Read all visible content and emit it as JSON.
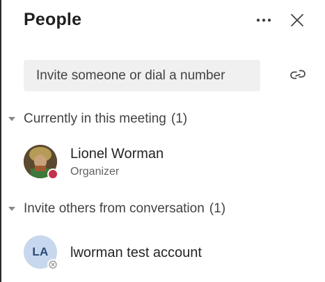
{
  "panel": {
    "title": "People"
  },
  "header": {
    "more_icon": "more-horizontal-icon",
    "close_icon": "close-icon"
  },
  "invite": {
    "placeholder": "Invite someone or dial a number",
    "link_icon": "link-icon"
  },
  "sections": [
    {
      "label": "Currently in this meeting",
      "count": "(1)",
      "people": [
        {
          "name": "Lionel Worman",
          "role": "Organizer",
          "avatar_type": "photo",
          "status": "busy",
          "status_color": "#c4314b"
        }
      ]
    },
    {
      "label": "Invite others from conversation",
      "count": "(1)",
      "people": [
        {
          "name": "lworman test account",
          "initials": "LA",
          "avatar_type": "initials",
          "avatar_color": "#c7d7ed",
          "status": "offline"
        }
      ]
    }
  ]
}
